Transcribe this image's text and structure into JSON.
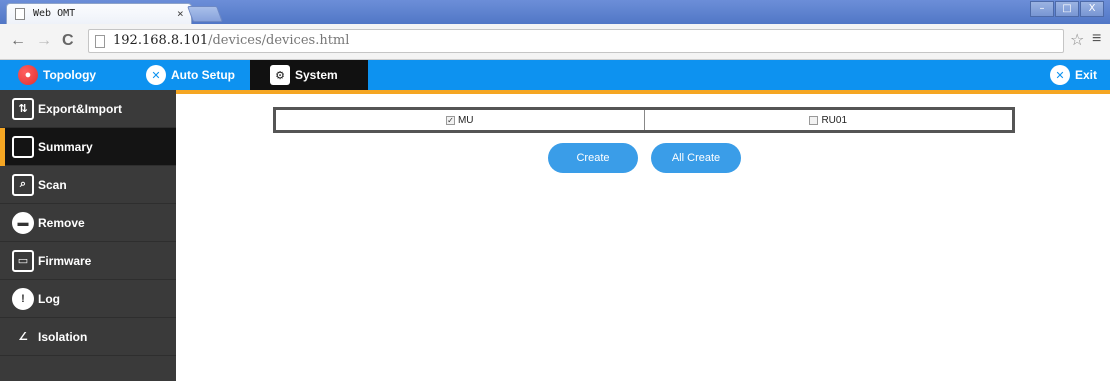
{
  "browser": {
    "tab_title": "Web OMT",
    "tab_close": "×",
    "window_buttons": [
      "–",
      "□",
      "X"
    ],
    "back_arrow": "←",
    "forward_arrow": "→",
    "reload": "C",
    "url_host": "192.168.8.101",
    "url_path": "/devices/devices.html",
    "star": "☆",
    "menu": "≡"
  },
  "appnav": {
    "topology": "Topology",
    "auto_setup": "Auto Setup",
    "system": "System",
    "exit": "Exit"
  },
  "sidebar": {
    "items": [
      {
        "label": "Export&Import",
        "icon": "export-import-icon",
        "glyph": "⇅"
      },
      {
        "label": "Summary",
        "icon": "summary-icon",
        "glyph": ""
      },
      {
        "label": "Scan",
        "icon": "scan-icon",
        "glyph": "⌕"
      },
      {
        "label": "Remove",
        "icon": "remove-icon",
        "glyph": "▬"
      },
      {
        "label": "Firmware",
        "icon": "firmware-icon",
        "glyph": "▭"
      },
      {
        "label": "Log",
        "icon": "log-icon",
        "glyph": "!"
      },
      {
        "label": "Isolation",
        "icon": "isolation-icon",
        "glyph": "∠"
      }
    ],
    "active": "Summary"
  },
  "main": {
    "choices": [
      {
        "label": "MU",
        "checked": true
      },
      {
        "label": "RU01",
        "checked": false
      }
    ],
    "create_label": "Create",
    "all_create_label": "All Create"
  },
  "colors": {
    "appnav": "#0d92f0",
    "sidebar": "#3a3a3a",
    "accent": "#f5a623",
    "button": "#3a9de8"
  }
}
